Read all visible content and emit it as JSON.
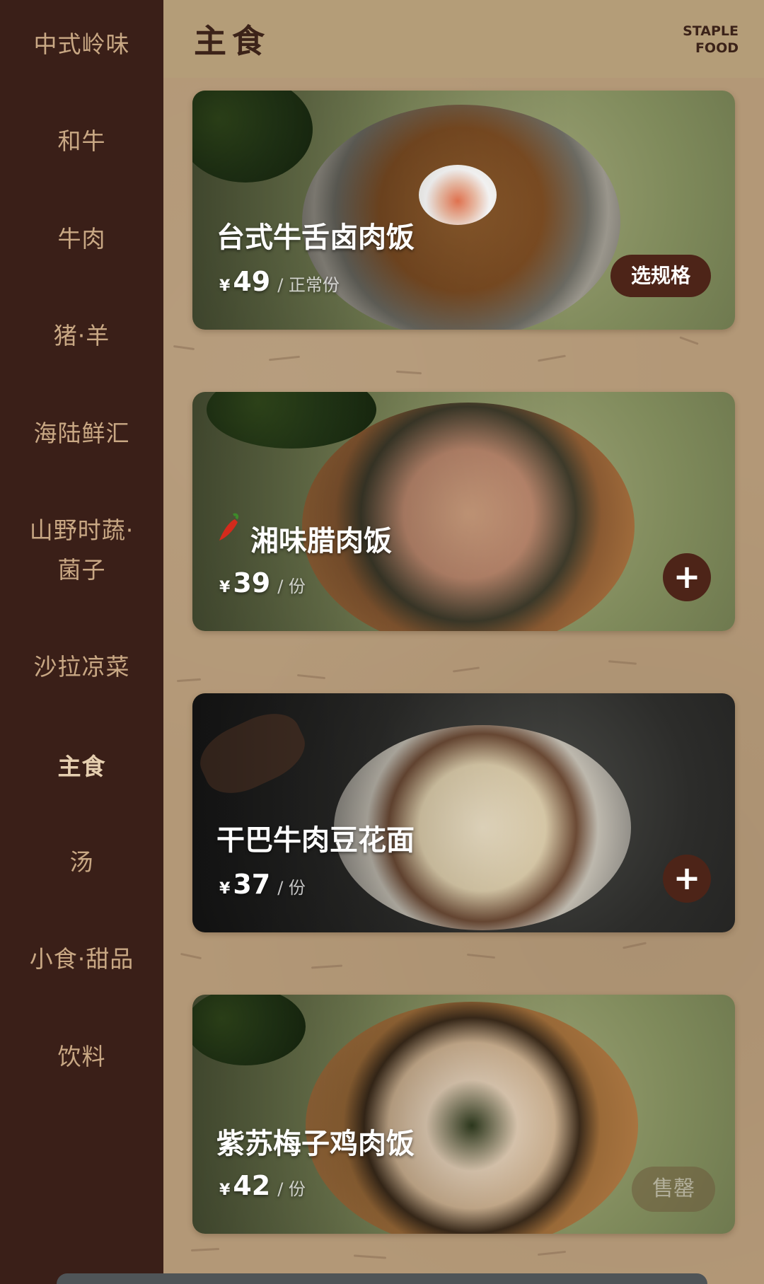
{
  "sidebar": {
    "items": [
      {
        "label": "中式岭味"
      },
      {
        "label": "和牛"
      },
      {
        "label": "牛肉"
      },
      {
        "label": "猪·羊"
      },
      {
        "label": "海陆鲜汇"
      },
      {
        "label": "山野时蔬·"
      },
      {
        "label": "菌子"
      },
      {
        "label": "沙拉凉菜"
      },
      {
        "label": "主食",
        "active": true
      },
      {
        "label": "汤"
      },
      {
        "label": "小食·甜品"
      },
      {
        "label": "饮料"
      }
    ]
  },
  "header": {
    "title": "主食",
    "en_line1": "STAPLE",
    "en_line2": "FOOD"
  },
  "dishes": [
    {
      "name": "台式牛舌卤肉饭",
      "currency": "¥",
      "price": "49",
      "unit": "/ 正常份",
      "action": "选规格",
      "spicy": false
    },
    {
      "name": "湘味腊肉饭",
      "currency": "¥",
      "price": "39",
      "unit": "/ 份",
      "action": "+",
      "spicy": true
    },
    {
      "name": "干巴牛肉豆花面",
      "currency": "¥",
      "price": "37",
      "unit": "/ 份",
      "action": "+",
      "spicy": false
    },
    {
      "name": "紫苏梅子鸡肉饭",
      "currency": "¥",
      "price": "42",
      "unit": "/ 份",
      "action": "售罄",
      "spicy": false
    }
  ],
  "colors": {
    "sidebar_bg": "#3a1f18",
    "accent_button": "#4d2418",
    "paper_bg": "#b39877"
  }
}
